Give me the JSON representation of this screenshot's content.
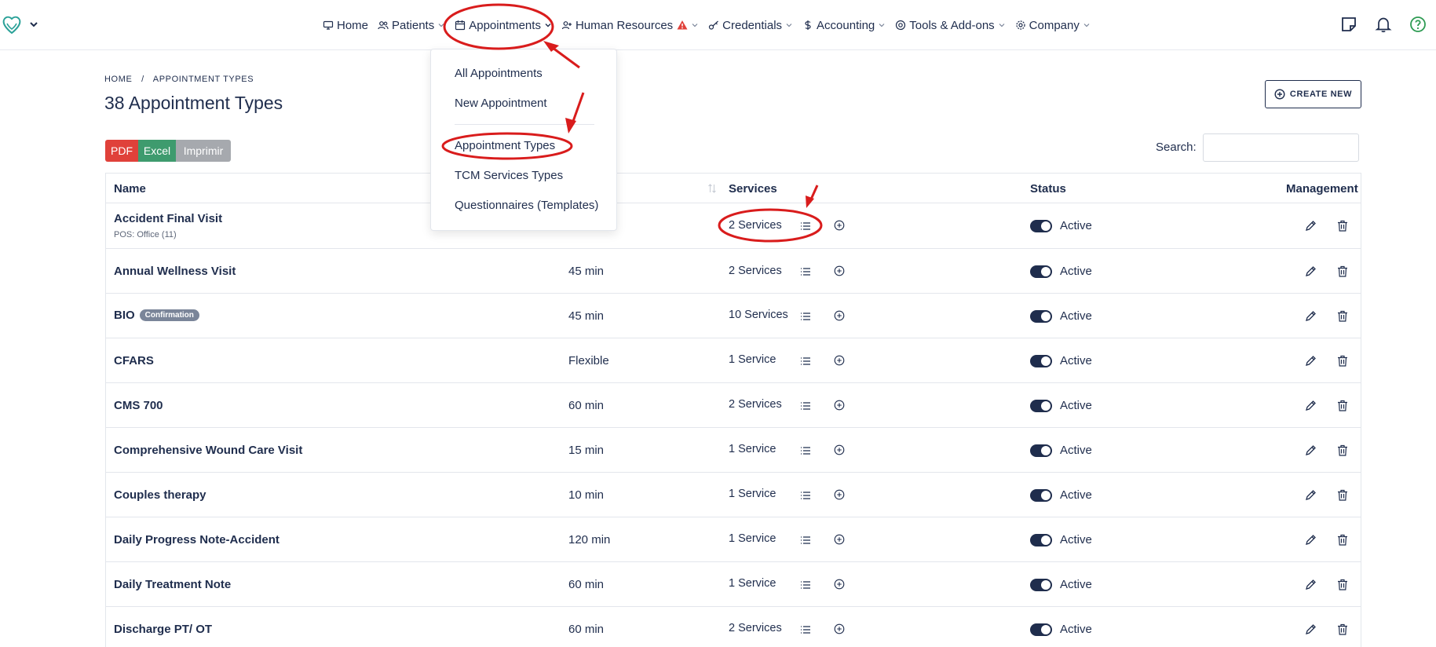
{
  "nav": {
    "items": [
      {
        "label": "Home",
        "icon": "monitor-icon",
        "chevron": false
      },
      {
        "label": "Patients",
        "icon": "users-icon",
        "chevron": true
      },
      {
        "label": "Appointments",
        "icon": "calendar-icon",
        "chevron": true
      },
      {
        "label": "Human Resources",
        "icon": "user-plus-icon",
        "chevron": true,
        "warning": true
      },
      {
        "label": "Credentials",
        "icon": "key-icon",
        "chevron": true
      },
      {
        "label": "Accounting",
        "icon": "dollar-icon",
        "chevron": true
      },
      {
        "label": "Tools & Add-ons",
        "icon": "at-icon",
        "chevron": true
      },
      {
        "label": "Company",
        "icon": "gear-icon",
        "chevron": true
      }
    ]
  },
  "dropdown": {
    "items": [
      "All Appointments",
      "New Appointment",
      "Appointment Types",
      "TCM Services Types",
      "Questionnaires (Templates)"
    ]
  },
  "breadcrumb": {
    "home": "HOME",
    "sep": "/",
    "current": "APPOINTMENT TYPES"
  },
  "page": {
    "title": "38 Appointment Types",
    "create_label": "CREATE NEW"
  },
  "export": {
    "pdf": "PDF",
    "excel": "Excel",
    "print": "Imprimir"
  },
  "search": {
    "label": "Search:",
    "value": ""
  },
  "table": {
    "headers": {
      "name": "Name",
      "services": "Services",
      "status": "Status",
      "management": "Management"
    },
    "rows": [
      {
        "name": "Accident Final Visit",
        "sub": "POS: Office (11)",
        "duration": "",
        "services": "2 Services",
        "status": "Active"
      },
      {
        "name": "Annual Wellness Visit",
        "duration": "45 min",
        "services": "2 Services",
        "status": "Active"
      },
      {
        "name": "BIO",
        "badge": "Confirmation",
        "duration": "45 min",
        "services": "10 Services",
        "status": "Active"
      },
      {
        "name": "CFARS",
        "duration": "Flexible",
        "services": "1 Service",
        "status": "Active"
      },
      {
        "name": "CMS 700",
        "duration": "60 min",
        "services": "2 Services",
        "status": "Active"
      },
      {
        "name": "Comprehensive Wound Care Visit",
        "duration": "15 min",
        "services": "1 Service",
        "status": "Active"
      },
      {
        "name": "Couples therapy",
        "duration": "10 min",
        "services": "1 Service",
        "status": "Active"
      },
      {
        "name": "Daily Progress Note-Accident",
        "duration": "120 min",
        "services": "1 Service",
        "status": "Active"
      },
      {
        "name": "Daily Treatment Note",
        "duration": "60 min",
        "services": "1 Service",
        "status": "Active"
      },
      {
        "name": "Discharge PT/ OT",
        "duration": "60 min",
        "services": "2 Services",
        "status": "Active"
      }
    ]
  },
  "colors": {
    "primary": "#1f2d4d",
    "pdf": "#e0413a",
    "excel": "#3e9b6e",
    "print": "#a6a9ae",
    "annotation": "#d91c1c"
  }
}
